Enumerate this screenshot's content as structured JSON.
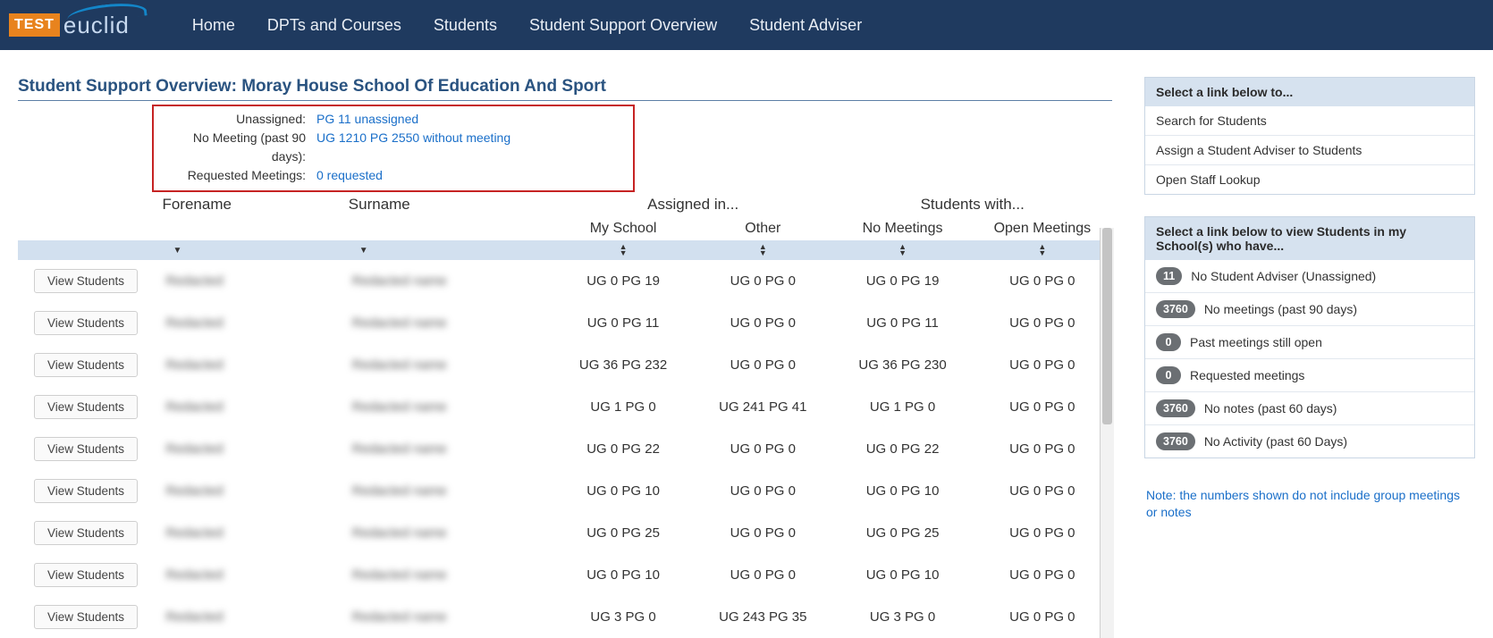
{
  "nav": {
    "logo_test": "TEST",
    "logo_word": "euclid",
    "items": [
      "Home",
      "DPTs and Courses",
      "Students",
      "Student Support Overview",
      "Student Adviser"
    ]
  },
  "title": "Student Support Overview: Moray House School Of Education And Sport",
  "summary": {
    "unassigned_label": "Unassigned:",
    "unassigned_value": "PG 11 unassigned",
    "nomeeting_label": "No Meeting (past 90 days):",
    "nomeeting_value": "UG 1210 PG 2550 without meeting",
    "requested_label": "Requested Meetings:",
    "requested_value": "0 requested"
  },
  "headers": {
    "forename": "Forename",
    "surname": "Surname",
    "assigned_in": "Assigned in...",
    "students_with": "Students with...",
    "my_school": "My School",
    "other": "Other",
    "no_meetings": "No Meetings",
    "open_meetings": "Open Meetings",
    "view_btn": "View Students"
  },
  "rows": [
    {
      "myschool": "UG 0 PG 19",
      "other": "UG 0 PG 0",
      "nomeet": "UG 0 PG 19",
      "open": "UG 0 PG 0"
    },
    {
      "myschool": "UG 0 PG 11",
      "other": "UG 0 PG 0",
      "nomeet": "UG 0 PG 11",
      "open": "UG 0 PG 0"
    },
    {
      "myschool": "UG 36 PG 232",
      "other": "UG 0 PG 0",
      "nomeet": "UG 36 PG 230",
      "open": "UG 0 PG 0"
    },
    {
      "myschool": "UG 1 PG 0",
      "other": "UG 241 PG 41",
      "nomeet": "UG 1 PG 0",
      "open": "UG 0 PG 0"
    },
    {
      "myschool": "UG 0 PG 22",
      "other": "UG 0 PG 0",
      "nomeet": "UG 0 PG 22",
      "open": "UG 0 PG 0"
    },
    {
      "myschool": "UG 0 PG 10",
      "other": "UG 0 PG 0",
      "nomeet": "UG 0 PG 10",
      "open": "UG 0 PG 0"
    },
    {
      "myschool": "UG 0 PG 25",
      "other": "UG 0 PG 0",
      "nomeet": "UG 0 PG 25",
      "open": "UG 0 PG 0"
    },
    {
      "myschool": "UG 0 PG 10",
      "other": "UG 0 PG 0",
      "nomeet": "UG 0 PG 10",
      "open": "UG 0 PG 0"
    },
    {
      "myschool": "UG 3 PG 0",
      "other": "UG 243 PG 35",
      "nomeet": "UG 3 PG 0",
      "open": "UG 0 PG 0"
    }
  ],
  "side": {
    "panel1_hdr": "Select a link below to...",
    "panel1_items": [
      "Search for Students",
      "Assign a Student Adviser to Students",
      "Open Staff Lookup"
    ],
    "panel2_hdr": "Select a link below to view Students in my School(s) who have...",
    "panel2_items": [
      {
        "count": "11",
        "text": "No Student Adviser (Unassigned)"
      },
      {
        "count": "3760",
        "text": "No meetings (past 90 days)"
      },
      {
        "count": "0",
        "text": "Past meetings still open"
      },
      {
        "count": "0",
        "text": "Requested meetings"
      },
      {
        "count": "3760",
        "text": "No notes (past 60 days)"
      },
      {
        "count": "3760",
        "text": "No Activity (past 60 Days)"
      }
    ],
    "note": "Note: the numbers shown do not include group meetings or notes"
  }
}
